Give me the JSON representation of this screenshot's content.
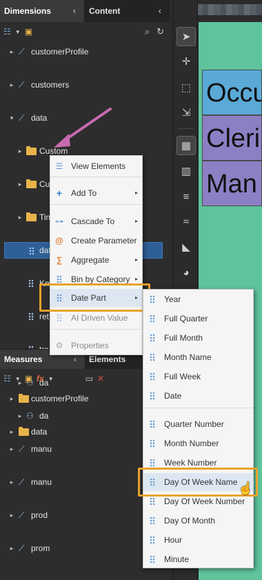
{
  "left_panel": {
    "tabs": [
      {
        "label": "Dimensions",
        "chevron": "‹"
      },
      {
        "label": "Content",
        "chevron": "‹"
      }
    ],
    "tree": [
      {
        "label": "customerProfile",
        "caret": "▸",
        "icon": "cube-icon"
      },
      {
        "label": "customers",
        "caret": "▸",
        "icon": "cube-icon"
      },
      {
        "label": "data",
        "caret": "▾",
        "icon": "cube-icon"
      },
      {
        "label": "Custom",
        "caret": "▸",
        "icon": "folder-icon"
      },
      {
        "label": "Custom Dates",
        "caret": "▸",
        "icon": "folder-icon"
      },
      {
        "label": "Time Intelligence",
        "caret": "▸",
        "icon": "folder-icon"
      },
      {
        "label": "dateKey",
        "caret": "",
        "icon": "dots-icon"
      },
      {
        "label": "Km",
        "caret": "",
        "icon": "dots-icon"
      },
      {
        "label": "ret",
        "caret": "",
        "icon": "dots-icon"
      },
      {
        "label": "tra",
        "caret": "",
        "icon": "dots-icon"
      },
      {
        "label": "da",
        "caret": "▸",
        "icon": "hierarchy-icon"
      },
      {
        "label": "da",
        "caret": "▸",
        "icon": "hierarchy-icon"
      },
      {
        "label": "manu",
        "caret": "▸",
        "icon": "cube-icon"
      },
      {
        "label": "manu",
        "caret": "▸",
        "icon": "cube-icon"
      },
      {
        "label": "prod",
        "caret": "▸",
        "icon": "cube-icon"
      },
      {
        "label": "prom",
        "caret": "▸",
        "icon": "cube-icon"
      }
    ],
    "measures_tabs": [
      {
        "label": "Measures",
        "chevron": "‹"
      },
      {
        "label": "Elements",
        "chevron": ""
      }
    ],
    "measures_tree": [
      {
        "label": "customerProfile",
        "caret": "▸"
      },
      {
        "label": "data",
        "caret": "▸"
      }
    ]
  },
  "canvas": {
    "info_icon": "i",
    "cells": [
      "Occu",
      "Cleri",
      "Man"
    ]
  },
  "context_menu": {
    "items": [
      {
        "label": "View Elements",
        "icon": "view-elements-icon",
        "has_submenu": false,
        "disabled": false
      },
      {
        "label": "Add To",
        "icon": "plus-icon",
        "has_submenu": true,
        "disabled": false
      },
      {
        "label": "Cascade To",
        "icon": "cascade-icon",
        "has_submenu": true,
        "disabled": false
      },
      {
        "label": "Create Parameter",
        "icon": "at-icon",
        "has_submenu": false,
        "disabled": false
      },
      {
        "label": "Aggregate",
        "icon": "sigma-icon",
        "has_submenu": true,
        "disabled": false
      },
      {
        "label": "Bin by Category",
        "icon": "bin-icon",
        "has_submenu": true,
        "disabled": false
      },
      {
        "label": "Date Part",
        "icon": "date-part-icon",
        "has_submenu": true,
        "disabled": false
      },
      {
        "label": "AI Driven Value",
        "icon": "ai-icon",
        "has_submenu": false,
        "disabled": true
      },
      {
        "label": "Properties",
        "icon": "gear-icon",
        "has_submenu": false,
        "disabled": true
      }
    ],
    "arrow_glyph": "▸"
  },
  "date_part_submenu": {
    "items": [
      "Year",
      "Full Quarter",
      "Full Month",
      "Month Name",
      "Full Week",
      "Date",
      "Quarter Number",
      "Month Number",
      "Week Number",
      "Day Of Week Name",
      "Day Of Week Number",
      "Day Of Month",
      "Hour",
      "Minute"
    ],
    "highlighted": "Day Of Week Name"
  },
  "colors": {
    "highlight_border": "#e8a22a",
    "selection": "#2f5f97",
    "canvas": "#5fc49c",
    "annotation_arrow": "#c86bb0"
  }
}
